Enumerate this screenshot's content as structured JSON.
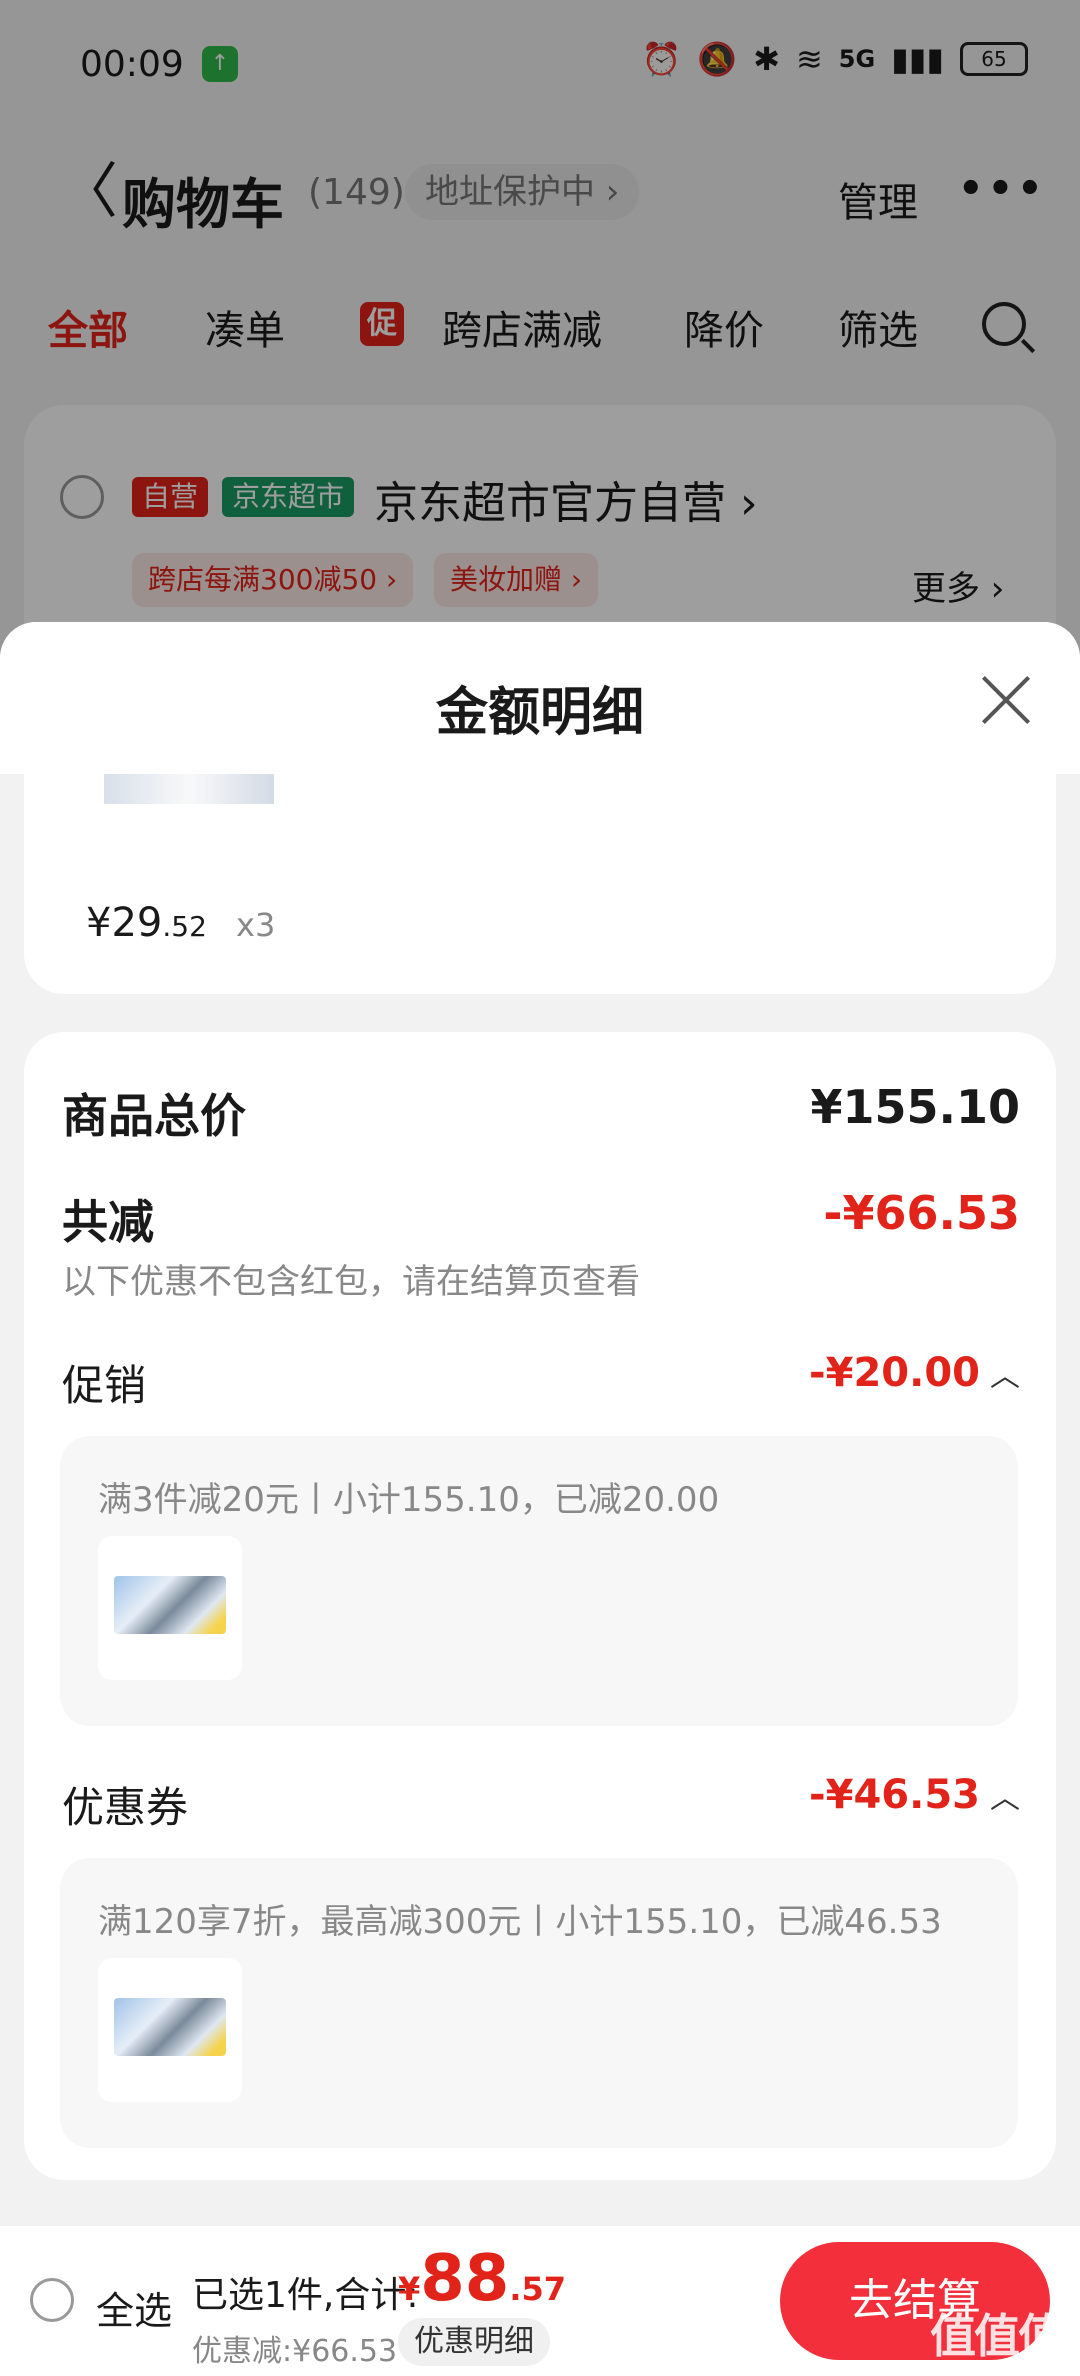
{
  "status_bar": {
    "time": "00:09",
    "network": "5G",
    "battery": "65"
  },
  "header": {
    "back": "〈",
    "title": "购物车",
    "count": "(149)",
    "address_protect": "地址保护中 ›",
    "manage": "管理",
    "more": "•••"
  },
  "tabs": {
    "all": "全部",
    "coudan": "凑单",
    "promo_badge": "促",
    "cross_store": "跨店满减",
    "price_drop": "降价",
    "filter": "筛选"
  },
  "store": {
    "tag_self": "自营",
    "tag_market": "京东超市",
    "name": "京东超市官方自营 ›",
    "chip_1": "跨店每满300减50 ›",
    "chip_2": "美妆加赠 ›",
    "more": "更多 ›"
  },
  "sheet": {
    "title": "金额明细",
    "item": {
      "price_int": "¥29",
      "price_dec": ".52",
      "qty": "x3"
    },
    "goods_total_label": "商品总价",
    "goods_total_value": "¥155.10",
    "reduce_label": "共减",
    "reduce_value": "-¥66.53",
    "reduce_note": "以下优惠不包含红包，请在结算页查看",
    "promo_label": "促销",
    "promo_value": "-¥20.00",
    "promo_detail": "满3件减20元丨小计155.10，已减20.00",
    "coupon_label": "优惠券",
    "coupon_value": "-¥46.53",
    "coupon_detail": "满120享7折，最高减300元丨小计155.10，已减46.53",
    "caret": "︿"
  },
  "bottom": {
    "select_all": "全选",
    "selected": "已选1件,合计:",
    "currency": "¥",
    "total_int": "88",
    "total_dec": ".57",
    "discount": "优惠减:¥66.53",
    "detail_button": "优惠明细",
    "checkout": "去结算"
  },
  "watermark": "值值值"
}
